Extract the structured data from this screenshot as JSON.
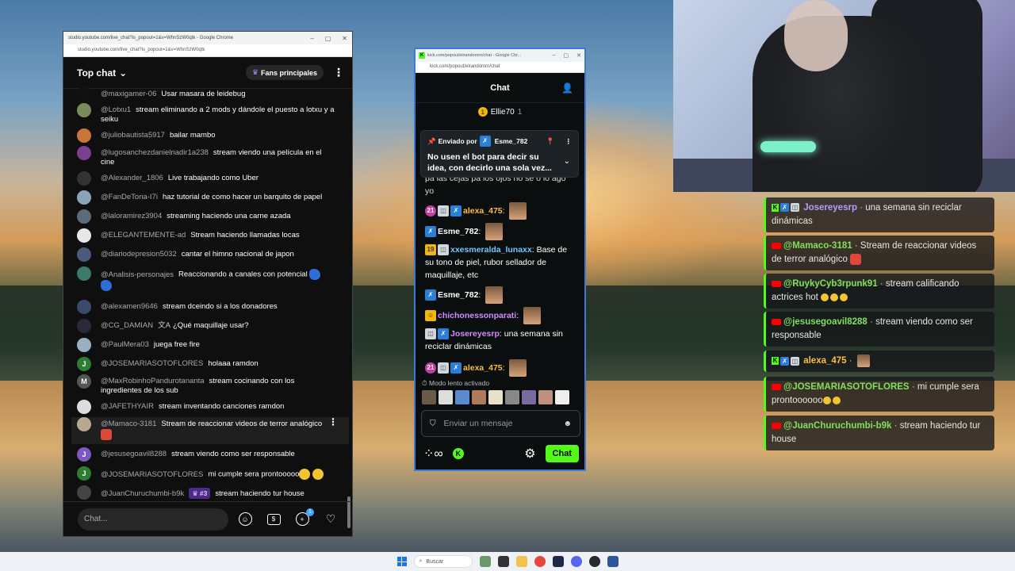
{
  "youtube": {
    "window_title": "studio.youtube.com/live_chat?is_popout=1&v=WhnSzW0qtk - Google Chrome",
    "url": "studio.youtube.com/live_chat?is_popout=1&v=WhnSzW0qtk",
    "chat_mode": "Top chat",
    "fans_button": "Fans principales",
    "messages": [
      {
        "author": "@maxigamer-06",
        "text": "Usar masara de leidebug",
        "avatar_color": "#111111",
        "avatar_letter": ""
      },
      {
        "author": "@Lotxu1",
        "text": "stream eliminando a 2 mods y dándole el puesto a lotxu y a seiku",
        "avatar_color": "#7a8b5a",
        "avatar_letter": ""
      },
      {
        "author": "@juliobautista5917",
        "text": "bailar mambo",
        "avatar_color": "#c9763d",
        "avatar_letter": ""
      },
      {
        "author": "@lugosanchezdanielnadir1a238",
        "text": "stream viendo una película en el cine",
        "avatar_color": "#7a3f8e",
        "avatar_letter": ""
      },
      {
        "author": "@Alexander_1806",
        "text": "Live trabajando como Uber",
        "avatar_color": "#333333",
        "avatar_letter": ""
      },
      {
        "author": "@FanDeTona-I7i",
        "text": "haz tutorial de como hacer un barquito de papel",
        "avatar_color": "#8aa4b8",
        "avatar_letter": ""
      },
      {
        "author": "@laloramirez3904",
        "text": "streaming haciendo una carne azada",
        "avatar_color": "#5a6b7a",
        "avatar_letter": ""
      },
      {
        "author": "@ELEGANTEMENTE-ad",
        "text": "Stream haciendo llamadas locas",
        "avatar_color": "#e8e8e8",
        "avatar_letter": ""
      },
      {
        "author": "@diariodepresion5032",
        "text": "cantar el himno nacional de japon",
        "avatar_color": "#4a5a7a",
        "avatar_letter": ""
      },
      {
        "author": "@Analisis-personajes",
        "text": "Reaccionando a canales con potencial",
        "avatar_color": "#3d7a6a",
        "avatar_letter": ""
      },
      {
        "author": "@alexamen9646",
        "text": "stream dceindo si a los donadores",
        "avatar_color": "#3a4a6a",
        "avatar_letter": ""
      },
      {
        "author": "@CG_DAMIAN",
        "text": "¿Qué maquillaje usar?",
        "avatar_color": "#2a2a3a",
        "avatar_letter": ""
      },
      {
        "author": "@PaulMera03",
        "text": "juega free fire",
        "avatar_color": "#9ab0c0",
        "avatar_letter": ""
      },
      {
        "author": "@JOSEMARIASOTOFLORES",
        "text": "holaaa ramdon",
        "avatar_color": "#2e7d32",
        "avatar_letter": "J"
      },
      {
        "author": "@MaxRobinhoPandurotananta",
        "text": "stream cocinando con los ingredientes de los sub",
        "avatar_color": "#555555",
        "avatar_letter": "M"
      },
      {
        "author": "@JAFETHYAIR",
        "text": "stream inventando canciones ramdon",
        "avatar_color": "#dddddd",
        "avatar_letter": ""
      },
      {
        "author": "@Mamaco-3181",
        "text": "Stream de reaccionar videos de terror analógico",
        "avatar_color": "#b8a890",
        "avatar_letter": ""
      },
      {
        "author": "@jesusegoavil8288",
        "text": "stream viendo como ser responsable",
        "avatar_color": "#7e57c2",
        "avatar_letter": "J"
      },
      {
        "author": "@JOSEMARIASOTOFLORES",
        "text": "mi cumple sera prontooooo",
        "avatar_color": "#2e7d32",
        "avatar_letter": "J"
      },
      {
        "author": "@JuanChuruchumbi-b9k",
        "text": "stream haciendo tur house",
        "avatar_color": "#444444",
        "avatar_letter": "",
        "badge": "#3"
      }
    ],
    "input_placeholder": "Chat...",
    "notification_count": "1"
  },
  "kick": {
    "window_title": "kick.com/popout/elrandomrn/chat - Google Chr...",
    "url": "kick.com/popout/elrandomrn/chat",
    "header": "Chat",
    "leader_name": "Ellie70",
    "leader_coin": "1",
    "leader_count": "1",
    "pinned_label": "Enviado por",
    "pinned_user": "Esme_782",
    "pinned_text": "No usen el bot para decir su idea, con decirlo una sola vez...",
    "partial_text": "pa las cejas pa los ojos no se o lo ago yo",
    "messages": [
      {
        "user": "alexa_475",
        "text": "",
        "color": "#fcbf3f",
        "badges": [
          "sub",
          "gray",
          "blue"
        ],
        "face": true
      },
      {
        "user": "Esme_782",
        "text": "",
        "color": "#ffffff",
        "badges": [
          "blue"
        ],
        "face": true
      },
      {
        "user": "xxesmeralda_lunaxx",
        "text": "Base de su tono de piel, rubor sellador de maquillaje, etc",
        "color": "#6ec8ff",
        "badges": [
          "gold",
          "gray"
        ],
        "face": false
      },
      {
        "user": "Esme_782",
        "text": "",
        "color": "#ffffff",
        "badges": [
          "blue"
        ],
        "face": true
      },
      {
        "user": "chichonessonparati",
        "text": "",
        "color": "#d18cff",
        "badges": [
          "gray"
        ],
        "face": true
      },
      {
        "user": "Josereyesrp",
        "text": "una semana sin reciclar dinámicas",
        "color": "#d18cff",
        "badges": [
          "gray",
          "blue"
        ],
        "face": false
      },
      {
        "user": "alexa_475",
        "text": "",
        "color": "#fcbf3f",
        "badges": [
          "sub",
          "gray",
          "blue"
        ],
        "face": true
      }
    ],
    "slow_mode": "Modo lento activado",
    "input_placeholder": "Enviar un mensaje",
    "chat_button": "Chat"
  },
  "overlay": [
    {
      "platform": "kick",
      "user": "Josereyesrp",
      "text": "una semana sin reciclar dinámicas"
    },
    {
      "platform": "youtube",
      "user": "@Mamaco-3181",
      "text": "Stream de reaccionar videos de terror analógico"
    },
    {
      "platform": "youtube",
      "user": "@RuykyCyb3rpunk91",
      "text": "stream calificando actrices hot"
    },
    {
      "platform": "youtube",
      "user": "@jesusegoavil8288",
      "text": "stream viendo como ser responsable"
    },
    {
      "platform": "kick",
      "user": "alexa_475",
      "text": ""
    },
    {
      "platform": "youtube",
      "user": "@JOSEMARIASOTOFLORES",
      "text": "mi cumple sera prontoooooo"
    },
    {
      "platform": "youtube",
      "user": "@JuanChuruchumbi-b9k",
      "text": "stream haciendo tur house"
    }
  ],
  "taskbar": {
    "search_label": "Buscar"
  },
  "colors": {
    "kick_green": "#53fc18",
    "youtube_red": "#ff0000",
    "yt_purple_badge": "#4c2a8a"
  }
}
